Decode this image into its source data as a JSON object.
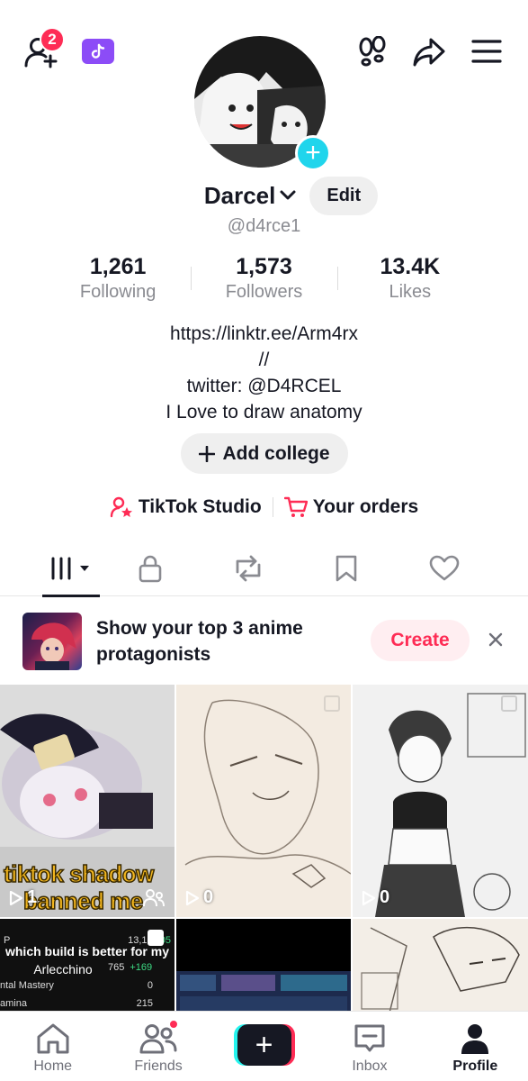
{
  "header": {
    "friend_requests_count": "2",
    "icons": [
      "add-friend-icon",
      "tiktok-studio-badge-icon",
      "footprints-icon",
      "share-icon",
      "menu-icon"
    ]
  },
  "profile": {
    "display_name": "Darcel",
    "edit_label": "Edit",
    "handle": "@d4rce1",
    "stats": [
      {
        "value": "1,261",
        "label": "Following"
      },
      {
        "value": "1,573",
        "label": "Followers"
      },
      {
        "value": "13.4K",
        "label": "Likes"
      }
    ],
    "bio": [
      "https://linktr.ee/Arm4rx",
      "//",
      "twitter: @D4RCEL",
      "I Love to draw anatomy"
    ],
    "add_college_label": "Add college"
  },
  "links": {
    "studio_label": "TikTok Studio",
    "orders_label": "Your orders"
  },
  "tabs": [
    {
      "icon": "grid-icon",
      "active": true
    },
    {
      "icon": "lock-icon",
      "active": false
    },
    {
      "icon": "repost-icon",
      "active": false
    },
    {
      "icon": "bookmark-icon",
      "active": false
    },
    {
      "icon": "heart-icon",
      "active": false
    }
  ],
  "promo": {
    "text": "Show your top 3 anime protagonists",
    "create_label": "Create"
  },
  "videos": [
    {
      "views": "1",
      "caption_line1": "tiktok shadow",
      "caption_line2": "banned me"
    },
    {
      "views": "0"
    },
    {
      "views": "0"
    },
    {
      "caption": "which build is better for my",
      "subcaption": "Arlecchino",
      "stat_rows": [
        {
          "label": "P",
          "value": "13,10",
          "delta": "005"
        },
        {
          "label": "",
          "value": "765",
          "delta": "+169"
        },
        {
          "label": "ntal Mastery",
          "value": "0",
          "delta": ""
        },
        {
          "label": "amina",
          "value": "215",
          "delta": ""
        }
      ]
    },
    {},
    {}
  ],
  "bottom_nav": [
    {
      "label": "Home",
      "icon": "home-icon"
    },
    {
      "label": "Friends",
      "icon": "friends-icon"
    },
    {
      "label": "",
      "icon": "create-plus-icon"
    },
    {
      "label": "Inbox",
      "icon": "inbox-icon"
    },
    {
      "label": "Profile",
      "icon": "profile-icon"
    }
  ],
  "colors": {
    "accent": "#fe2c55",
    "cyan": "#25f4ee",
    "text": "#161823",
    "muted": "#8a8b91"
  }
}
